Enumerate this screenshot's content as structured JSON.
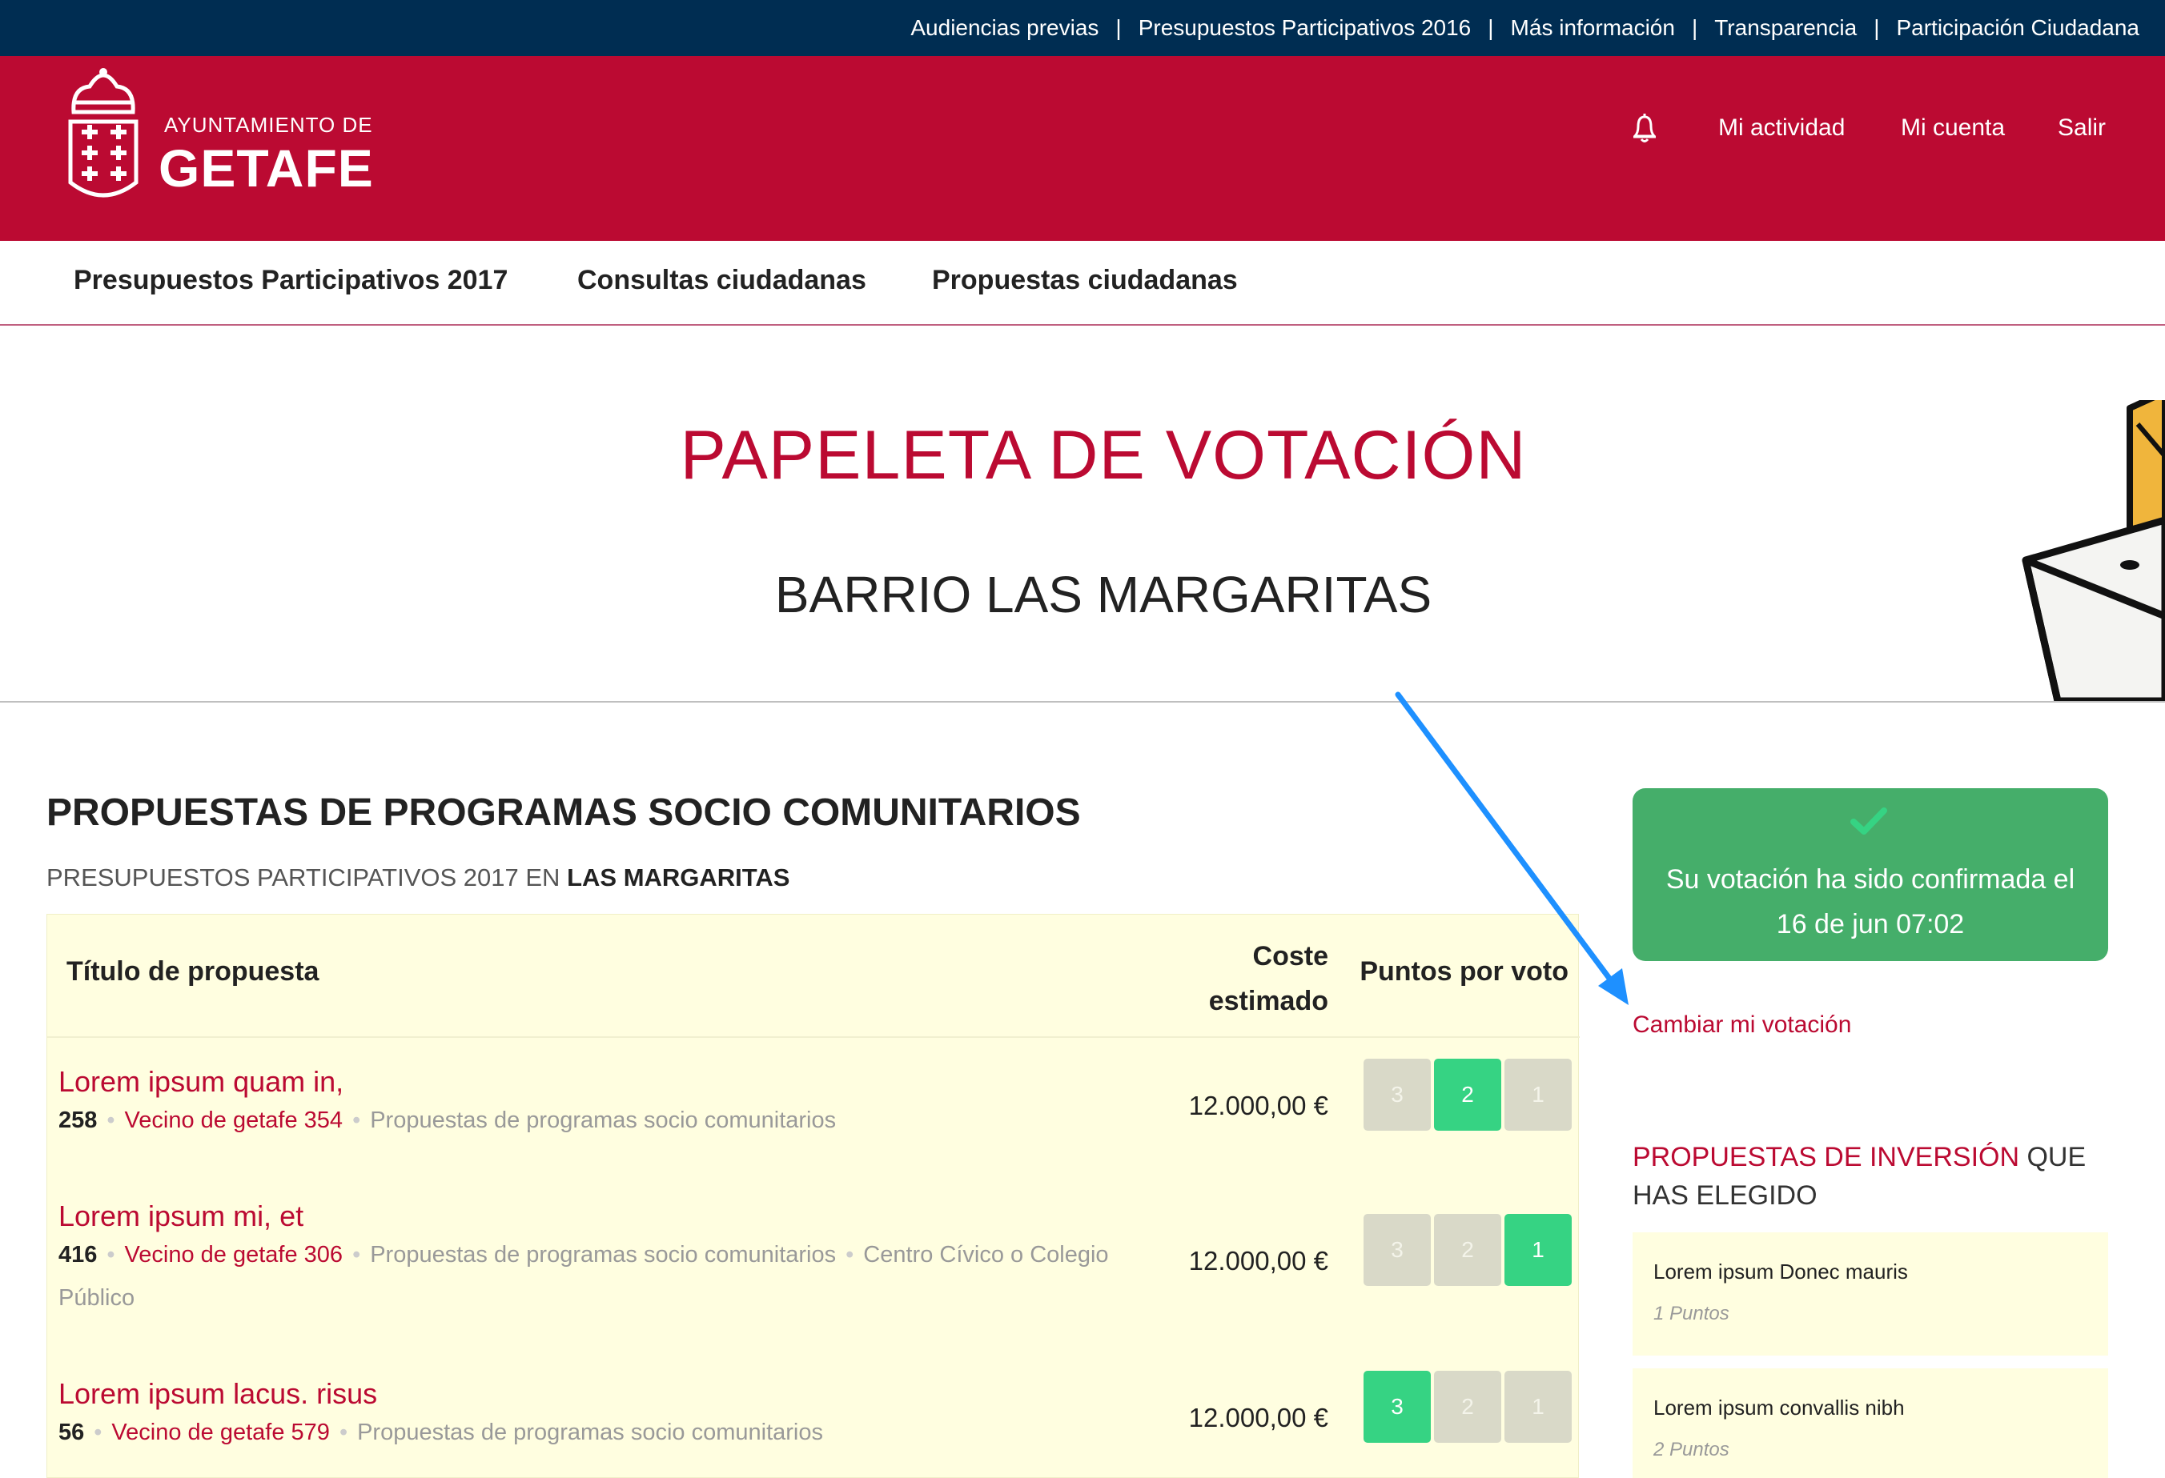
{
  "topbar": {
    "links": [
      "Audiencias previas",
      "Presupuestos Participativos 2016",
      "Más información",
      "Transparencia",
      "Participación Ciudadana"
    ],
    "separator": "|"
  },
  "header": {
    "logo_top": "AYUNTAMIENTO DE",
    "logo_main": "GETAFE",
    "nav": {
      "activity": "Mi actividad",
      "account": "Mi cuenta",
      "logout": "Salir"
    },
    "notifications_icon": "bell-icon"
  },
  "mainnav": {
    "items": [
      "Presupuestos Participativos 2017",
      "Consultas ciudadanas",
      "Propuestas ciudadanas"
    ]
  },
  "hero": {
    "title": "PAPELETA DE VOTACIÓN",
    "subtitle": "BARRIO LAS MARGARITAS"
  },
  "section": {
    "title": "PROPUESTAS DE PROGRAMAS SOCIO COMUNITARIOS",
    "subtitle_prefix": "PRESUPUESTOS PARTICIPATIVOS 2017 EN",
    "subtitle_place": "LAS MARGARITAS"
  },
  "table": {
    "headers": {
      "title": "Título de propuesta",
      "cost_line1": "Coste",
      "cost_line2": "estimado",
      "points": "Puntos por voto"
    },
    "rows": [
      {
        "title": "Lorem ipsum quam in,",
        "number": "258",
        "author": "Vecino de getafe 354",
        "category": "Propuestas de programas socio comunitarios",
        "location": "",
        "cost": "12.000,00 €",
        "options": [
          "3",
          "2",
          "1"
        ],
        "selected": "2"
      },
      {
        "title": "Lorem ipsum mi, et",
        "number": "416",
        "author": "Vecino de getafe 306",
        "category": "Propuestas de programas socio comunitarios",
        "location": "Centro Cívico o Colegio Público",
        "cost": "12.000,00 €",
        "options": [
          "3",
          "2",
          "1"
        ],
        "selected": "1"
      },
      {
        "title": "Lorem ipsum lacus. risus",
        "number": "56",
        "author": "Vecino de getafe 579",
        "category": "Propuestas de programas socio comunitarios",
        "location": "",
        "cost": "12.000,00 €",
        "options": [
          "3",
          "2",
          "1"
        ],
        "selected": "3"
      }
    ]
  },
  "sidebar": {
    "confirm_icon": "check-icon",
    "confirm_line1": "Su votación ha sido confirmada el",
    "confirm_line2": "16 de jun 07:02",
    "change_vote": "Cambiar mi votación",
    "chosen_title_red": "PROPUESTAS DE INVERSIÓN",
    "chosen_title_rest": " QUE HAS ELEGIDO",
    "cards": [
      {
        "name": "Lorem ipsum Donec mauris",
        "points": "1 Puntos"
      },
      {
        "name": "Lorem ipsum convallis nibh",
        "points": "2 Puntos"
      }
    ]
  },
  "colors": {
    "topbar": "#002d52",
    "brand_red": "#bb0a32",
    "confirm_green": "#45ae6a",
    "selected_point": "#36d383",
    "table_bg": "#fffee0",
    "annotation_arrow": "#1e90ff"
  }
}
